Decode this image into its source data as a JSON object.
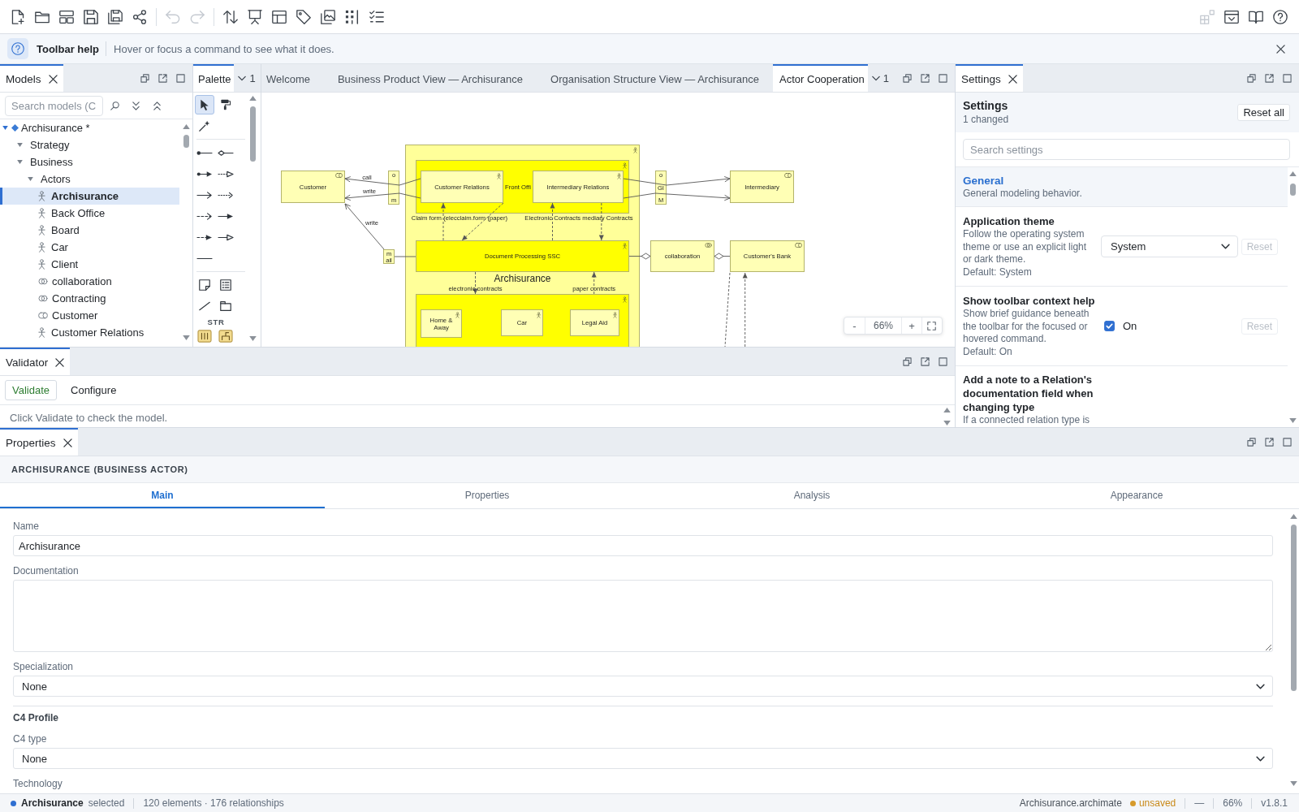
{
  "toolbar": {
    "groups": [
      [
        {
          "disabled": false
        },
        {
          "disabled": false
        },
        {
          "disabled": false
        },
        {
          "disabled": false
        },
        {
          "disabled": false
        },
        {
          "disabled": false
        }
      ],
      [
        {
          "disabled": true
        },
        {
          "disabled": true
        }
      ],
      [
        {
          "disabled": false
        },
        {
          "disabled": false
        },
        {
          "disabled": false
        },
        {
          "disabled": false
        },
        {
          "disabled": false
        },
        {
          "disabled": false
        },
        {
          "disabled": false
        }
      ]
    ],
    "right": [
      {
        "disabled": true
      },
      {
        "disabled": false
      },
      {
        "disabled": false
      },
      {
        "disabled": false
      }
    ]
  },
  "help_bar": {
    "title": "Toolbar help",
    "text": "Hover or focus a command to see what it does."
  },
  "models_panel": {
    "tabs": [
      {
        "label": "Models",
        "selected": true,
        "closable": true
      }
    ],
    "search": {
      "placeholder": "Search models (C"
    },
    "tree": [
      {
        "kind": "model",
        "label": "Archisurance *",
        "expanded": true,
        "selected": false,
        "children": [
          {
            "label": "Strategy",
            "expanded": true,
            "selected": false
          },
          {
            "label": "Business",
            "expanded": true,
            "selected": false,
            "children": [
              {
                "label": "Actors",
                "expanded": true,
                "selected": false,
                "children": [
                  {
                    "kind": "actor",
                    "label": "Archisurance",
                    "selected": true
                  },
                  {
                    "kind": "actor",
                    "label": "Back Office",
                    "selected": false
                  },
                  {
                    "kind": "actor",
                    "label": "Board",
                    "selected": false
                  },
                  {
                    "kind": "actor",
                    "label": "Car",
                    "selected": false
                  },
                  {
                    "kind": "actor",
                    "label": "Client",
                    "selected": false
                  },
                  {
                    "kind": "collaboration",
                    "label": "collaboration",
                    "selected": false
                  },
                  {
                    "kind": "collaboration",
                    "label": "Contracting",
                    "selected": false
                  },
                  {
                    "kind": "role",
                    "label": "Customer",
                    "selected": false
                  },
                  {
                    "kind": "actor",
                    "label": "Customer Relations",
                    "selected": false
                  }
                ]
              }
            ]
          }
        ]
      }
    ]
  },
  "palette_panel": {
    "tabs": [
      {
        "label": "Palette",
        "selected": true,
        "closable": false
      }
    ],
    "overflow": "1",
    "sections": [
      {
        "tools": [
          {
            "selected": true
          },
          {
            "selected": false
          },
          {
            "selected": false
          }
        ]
      },
      {
        "tools": [
          {
            "selected": false
          },
          {
            "selected": false
          },
          {
            "selected": false
          },
          {
            "selected": false
          },
          {
            "selected": false
          },
          {
            "selected": false
          },
          {
            "selected": false
          },
          {
            "selected": false
          },
          {
            "selected": false
          },
          {
            "selected": false
          },
          {
            "selected": false
          }
        ]
      },
      {
        "tools": [
          {
            "selected": false
          },
          {
            "selected": false
          },
          {
            "selected": false
          },
          {
            "selected": false
          }
        ]
      },
      {
        "title": "STR",
        "tools": [
          {
            "selected": false
          },
          {
            "selected": false
          }
        ]
      }
    ]
  },
  "editor": {
    "tabs": [
      {
        "label": "Welcome",
        "selected": false,
        "closable": false
      },
      {
        "label": "Business Product View — Archisurance",
        "selected": false,
        "closable": false
      },
      {
        "label": "Organisation Structure View — Archisurance",
        "selected": false,
        "closable": false
      },
      {
        "label": "Actor Cooperation",
        "selected": true,
        "closable": false
      }
    ],
    "overflow": "1",
    "diagram": {
      "nodes": [
        {
          "kind": "role",
          "label": "Customer",
          "color": "#ffffb5"
        },
        {
          "kind": "interface",
          "lines": [
            "o",
            "m"
          ],
          "color": "#ffffb5"
        },
        {
          "kind": "actor",
          "label": "Customer Relations",
          "color": "#ffffb5"
        },
        {
          "kind": "actor",
          "label": "Front Offi",
          "color": "#ffff00"
        },
        {
          "kind": "actor",
          "label": "Intermediary Relations",
          "color": "#ffffb5"
        },
        {
          "kind": "interface",
          "lines": [
            "o",
            "GI",
            "M"
          ],
          "color": "#ffffb5"
        },
        {
          "kind": "role",
          "label": "Intermediary",
          "color": "#ffffb5"
        },
        {
          "kind": "interface",
          "lines": [
            "m",
            "ail"
          ],
          "color": "#ffffb5"
        },
        {
          "kind": "actor",
          "label": "Document Processing SSC",
          "color": "#ffff00"
        },
        {
          "kind": "collaboration",
          "label": "collaboration",
          "color": "#ffffb5"
        },
        {
          "kind": "role",
          "label": "Customer's Bank",
          "color": "#ffffb5"
        },
        {
          "kind": "actor",
          "label": "Archisurance",
          "color": "#ffff99"
        },
        {
          "kind": "actor",
          "color": "#ffff00"
        },
        {
          "kind": "actor",
          "label": "Home & Away",
          "color": "#ffffb5"
        },
        {
          "kind": "actor",
          "label": "Car",
          "color": "#ffffb5"
        },
        {
          "kind": "actor",
          "label": "Legal Aid",
          "color": "#ffffb5"
        }
      ],
      "edges": [
        {
          "kind": "serving",
          "label": "call"
        },
        {
          "kind": "serving",
          "label": "write"
        },
        {
          "kind": "serving"
        },
        {
          "kind": "serving"
        },
        {
          "kind": "flow",
          "label": "Claim form (elecclaim.form (paper)"
        },
        {
          "kind": "flow"
        },
        {
          "kind": "flow",
          "label": "Electronic Contracts mediary Contracts"
        },
        {
          "kind": "flow"
        },
        {
          "kind": "serving",
          "label": "write"
        },
        {
          "kind": "line"
        },
        {
          "kind": "aggregation"
        },
        {
          "kind": "aggregation"
        },
        {
          "kind": "flow",
          "label": "electronic contracts"
        },
        {
          "kind": "flow",
          "label": "paper contracts"
        },
        {
          "kind": "dashed"
        },
        {
          "kind": "flow"
        }
      ]
    },
    "zoom": {
      "out": "-",
      "value": "66%",
      "in": "+"
    }
  },
  "settings_panel": {
    "tabs": [
      {
        "label": "Settings",
        "selected": true,
        "closable": true
      }
    ],
    "title": "Settings",
    "subtitle": "1 changed",
    "reset_all": "Reset all",
    "search": {
      "placeholder": "Search settings"
    },
    "items": [
      {
        "kind": "section",
        "title": "General",
        "description": "General modeling behavior."
      },
      {
        "kind": "select",
        "title": "Application theme",
        "description": "Follow the operating system theme or use an explicit light or dark theme.",
        "default": "Default: System",
        "value": "System",
        "reset": {
          "label": "Reset",
          "disabled": true
        }
      },
      {
        "kind": "checkbox",
        "title": "Show toolbar context help",
        "description": "Show brief guidance beneath the toolbar for the focused or hovered command.",
        "default": "Default: On",
        "checked": true,
        "value": "On",
        "reset": {
          "label": "Reset",
          "disabled": true
        }
      },
      {
        "kind": "text",
        "title": "Add a note to a Relation's documentation field when changing type",
        "description": "If a connected relation type is"
      }
    ]
  },
  "validator_panel": {
    "tabs": [
      {
        "label": "Validator",
        "selected": true,
        "closable": true
      }
    ],
    "buttons": [
      {
        "label": "Validate",
        "kind": "primary"
      },
      {
        "label": "Configure",
        "kind": "plain"
      }
    ],
    "message": "Click Validate to check the model."
  },
  "properties_panel": {
    "tabs": [
      {
        "label": "Properties",
        "selected": true,
        "closable": true
      }
    ],
    "heading": "ARCHISURANCE (BUSINESS ACTOR)",
    "subtabs": [
      {
        "label": "Main",
        "selected": true
      },
      {
        "label": "Properties",
        "selected": false
      },
      {
        "label": "Analysis",
        "selected": false
      },
      {
        "label": "Appearance",
        "selected": false
      }
    ],
    "fields": [
      {
        "kind": "text",
        "label": "Name",
        "value": "Archisurance"
      },
      {
        "kind": "textarea",
        "label": "Documentation"
      },
      {
        "kind": "select",
        "label": "Specialization",
        "value": "None"
      },
      {
        "kind": "heading",
        "label": "C4 Profile"
      },
      {
        "kind": "select",
        "label": "C4 type",
        "value": "None"
      },
      {
        "kind": "label",
        "label": "Technology"
      }
    ]
  },
  "status_bar": {
    "selection_name": "Archisurance",
    "selection_text": "selected",
    "counts": "120 elements · 176 relationships",
    "file": "Archisurance.archimate",
    "save_state": "unsaved",
    "mode": "—",
    "zoom": "66%",
    "version": "v1.8.1"
  }
}
